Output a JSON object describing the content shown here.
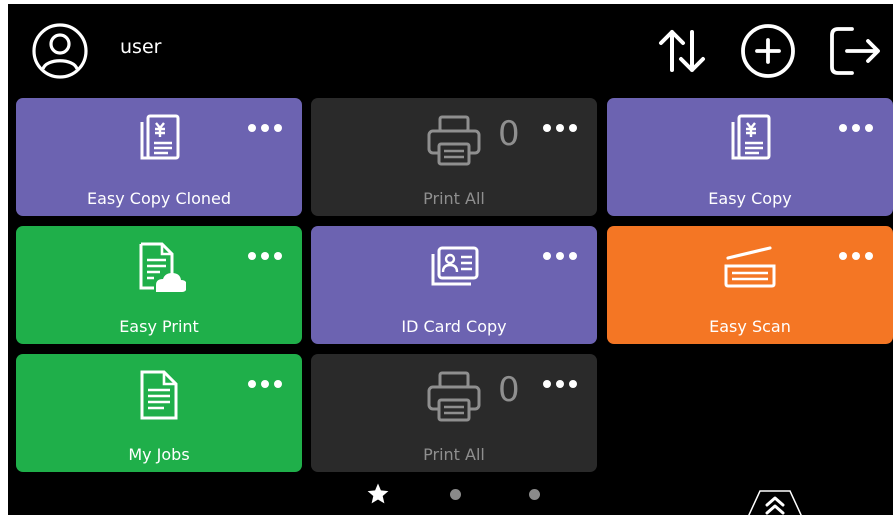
{
  "header": {
    "user_label": "user",
    "icons": [
      "user-avatar-icon",
      "sort-icon",
      "add-icon",
      "logout-icon"
    ]
  },
  "tiles": [
    {
      "label": "Easy Copy Cloned",
      "color": "#6c63b1",
      "icon": "copy-documents-icon"
    },
    {
      "label": "Print All",
      "color": "#2a2a2a",
      "icon": "printer-icon",
      "count": "0"
    },
    {
      "label": "Easy Copy",
      "color": "#6c63b1",
      "icon": "copy-documents-icon"
    },
    {
      "label": "Easy Print",
      "color": "#1faf4a",
      "icon": "cloud-document-icon"
    },
    {
      "label": "ID Card Copy",
      "color": "#6c63b1",
      "icon": "id-card-icon"
    },
    {
      "label": "Easy Scan",
      "color": "#f47624",
      "icon": "scanner-icon"
    },
    {
      "label": "My Jobs",
      "color": "#1faf4a",
      "icon": "document-icon"
    },
    {
      "label": "Print All",
      "color": "#2a2a2a",
      "icon": "printer-icon",
      "count": "0"
    }
  ],
  "pager": {
    "pages": 3,
    "current": 1,
    "icons": [
      "star-icon",
      "dot",
      "dot"
    ]
  },
  "colors": {
    "background": "#000000",
    "purple": "#6c63b1",
    "green": "#1faf4a",
    "orange": "#f47624",
    "dark": "#2a2a2a"
  }
}
